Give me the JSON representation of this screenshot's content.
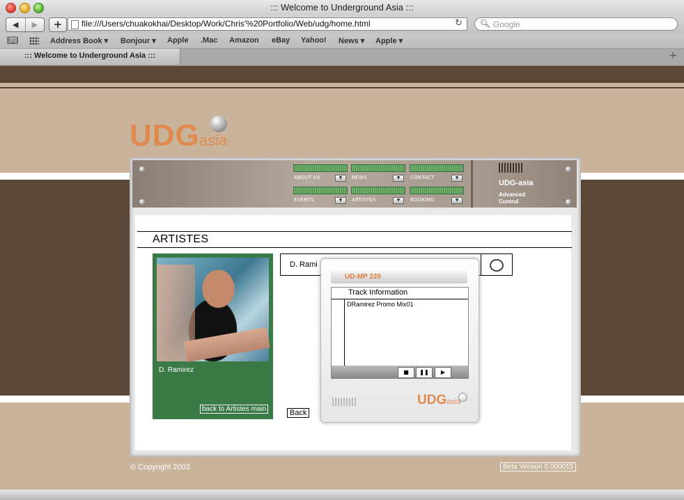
{
  "window": {
    "title": "::: Welcome to Underground Asia :::"
  },
  "toolbar": {
    "back_icon": "back-arrow-icon",
    "forward_icon": "forward-arrow-icon",
    "url": "file:///Users/chuakokhai/Desktop/Work/Chris'%20Portfolio/Web/udg/home.html",
    "search_placeholder": "Google"
  },
  "bookmarks": [
    "Address Book ▾",
    "Bonjour ▾",
    "Apple",
    ".Mac",
    "Amazon",
    "eBay",
    "Yahoo!",
    "News ▾",
    "Apple ▾"
  ],
  "tab": {
    "label": "::: Welcome to Underground Asia :::"
  },
  "site": {
    "logo_main": "UDG",
    "logo_sub": "asia",
    "nav": [
      {
        "label": "ABOUT US"
      },
      {
        "label": "NEWS"
      },
      {
        "label": "CONTACT"
      },
      {
        "label": "EVENTS"
      },
      {
        "label": "ARTISTES"
      },
      {
        "label": "BOOKING"
      }
    ],
    "console_brand": "UDG-asia",
    "console_sub1": "Advanced",
    "console_sub2": "Control",
    "heading": "ARTISTES",
    "artist_name": "D. Ramirez",
    "back_to_artists": "back to Artistes main",
    "select_text": "D. Rami",
    "back_button": "Back",
    "copyright": "© Copyright 2003",
    "beta": "Beta Version 0.000015"
  },
  "player": {
    "model": "UD-MP 220",
    "header": "Track Information",
    "track": "DRamirez Promo Mix01",
    "stop": "■",
    "pause": "❚❚",
    "play": "▶",
    "logo_main": "UDG",
    "logo_sub": "asia"
  }
}
